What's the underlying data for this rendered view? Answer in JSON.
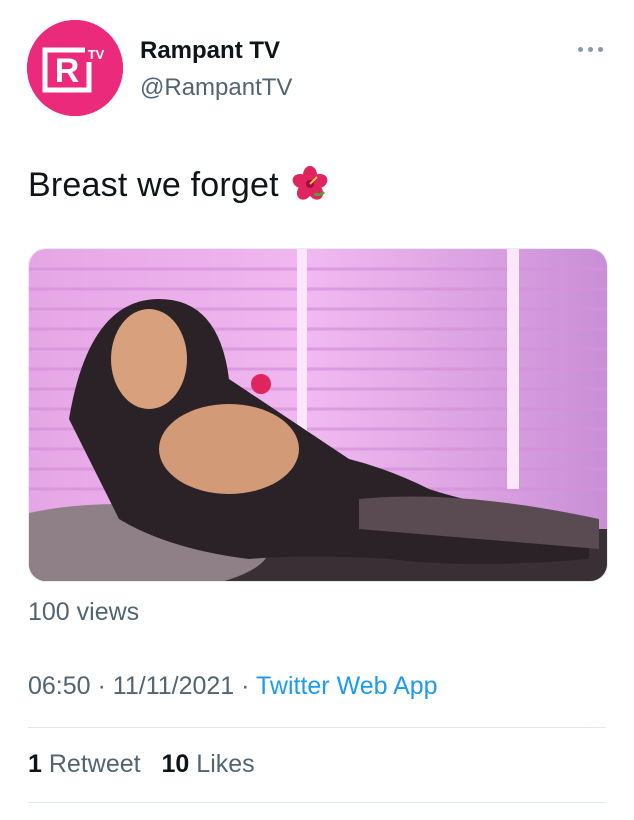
{
  "account": {
    "display_name": "Rampant TV",
    "handle": "@RampantTV",
    "avatar_icon": "rampant-tv-logo",
    "avatar_logo_text": "R TV",
    "brand_color": "#ec2a7c"
  },
  "tweet": {
    "text": "Breast we forget",
    "emoji_icon": "hibiscus-icon",
    "media_description_icon": "photo"
  },
  "views": "100 views",
  "meta": {
    "time": "06:50",
    "separator": "·",
    "date": "11/11/2021",
    "source": "Twitter Web App"
  },
  "stats": {
    "retweet_count": "1",
    "retweet_label": "Retweet",
    "like_count": "10",
    "like_label": "Likes"
  },
  "colors": {
    "link": "#1d9bf0",
    "secondary_text": "#536471",
    "primary_text": "#0f1419"
  }
}
